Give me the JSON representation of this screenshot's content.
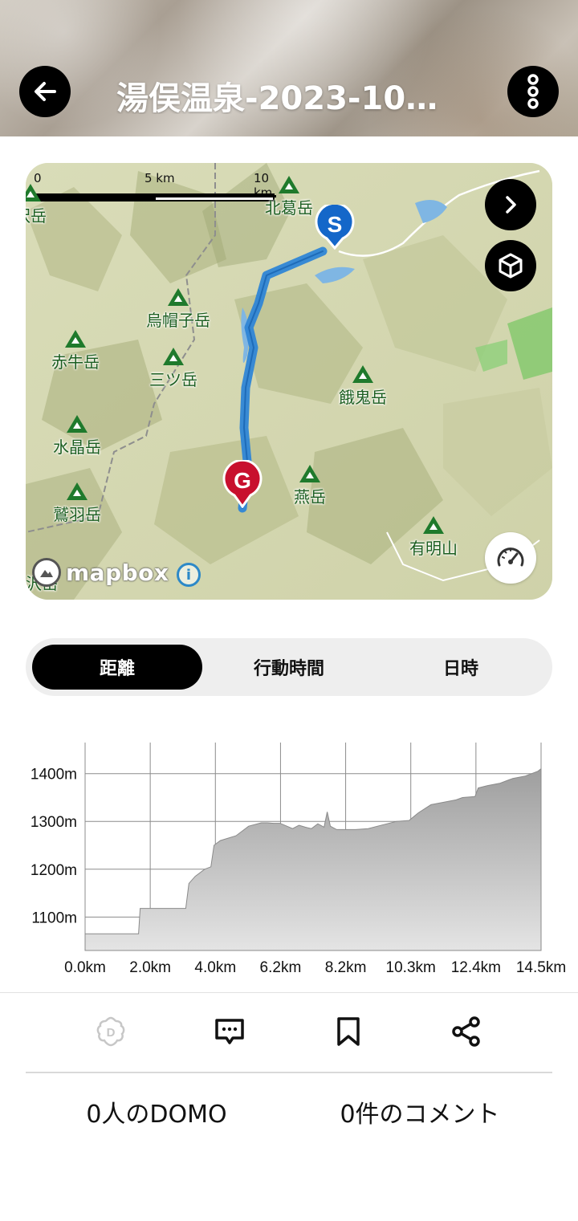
{
  "header": {
    "title": "湯俣温泉-2023-10…",
    "back_icon": "arrow-left-icon",
    "more_icon": "more-vertical-icon"
  },
  "map": {
    "scale": {
      "start": "0",
      "mid": "5 km",
      "end": "10 km"
    },
    "peaks": [
      "北葛岳",
      "烏帽子岳",
      "赤牛岳",
      "三ツ岳",
      "餓鬼岳",
      "水晶岳",
      "燕岳",
      "鷲羽岳",
      "有明山",
      "沢岳",
      "沢岳"
    ],
    "markers": {
      "start": "S",
      "goal": "G"
    },
    "attribution": "mapbox",
    "route_color": "#2f86d6",
    "start_color": "#1467c9",
    "goal_color": "#c8102e"
  },
  "tabs": [
    {
      "label": "距離",
      "active": true
    },
    {
      "label": "行動時間",
      "active": false
    },
    {
      "label": "日時",
      "active": false
    }
  ],
  "chart_data": {
    "type": "area",
    "xlabel": "",
    "ylabel": "",
    "x_ticks": [
      "0.0km",
      "2.0km",
      "4.0km",
      "6.2km",
      "8.2km",
      "10.3km",
      "12.4km",
      "14.5km"
    ],
    "y_ticks": [
      "1100m",
      "1200m",
      "1300m",
      "1400m"
    ],
    "ylim": [
      1030,
      1465
    ],
    "xlim": [
      0,
      14.5
    ],
    "grid": true,
    "series": [
      {
        "x": [
          0,
          1.7,
          1.75,
          3.2,
          3.3,
          3.5,
          3.8,
          4.0,
          4.1,
          4.3,
          4.8,
          5.2,
          5.6,
          5.8,
          6.0,
          6.2,
          6.6,
          6.8,
          7.0,
          7.2,
          7.4,
          7.6,
          7.7,
          7.8,
          8.0,
          8.2,
          8.6,
          9.0,
          9.3,
          9.6,
          9.9,
          10.3,
          10.6,
          11.0,
          11.4,
          11.8,
          12.0,
          12.4,
          12.5,
          12.8,
          13.2,
          13.6,
          14.0,
          14.4,
          14.5
        ],
        "y": [
          1065,
          1065,
          1118,
          1118,
          1170,
          1185,
          1200,
          1205,
          1250,
          1260,
          1270,
          1290,
          1297,
          1297,
          1296,
          1296,
          1285,
          1292,
          1288,
          1285,
          1295,
          1288,
          1320,
          1290,
          1283,
          1283,
          1283,
          1285,
          1290,
          1295,
          1300,
          1302,
          1318,
          1335,
          1340,
          1345,
          1350,
          1352,
          1370,
          1375,
          1380,
          1390,
          1395,
          1405,
          1410
        ]
      }
    ],
    "fill_color_top": "#9e9e9e",
    "fill_color_bottom": "#e4e4e4"
  },
  "actions": {
    "domo_icon": "domo-icon",
    "comment_icon": "comment-icon",
    "bookmark_icon": "bookmark-icon",
    "share_icon": "share-icon",
    "domo_count": "0人のDOMO",
    "comment_count": "0件のコメント"
  }
}
